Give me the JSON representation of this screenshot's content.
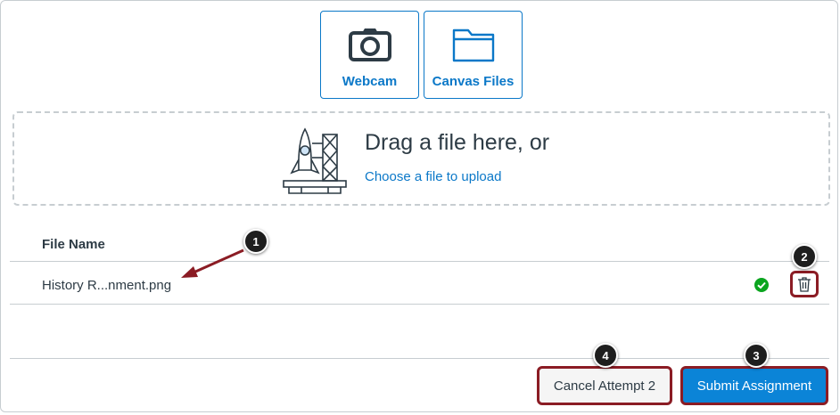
{
  "sources": {
    "webcam_label": "Webcam",
    "canvas_files_label": "Canvas Files"
  },
  "dropzone": {
    "title": "Drag a file here, or",
    "link": "Choose a file to upload"
  },
  "file_table": {
    "header": "File Name",
    "rows": [
      {
        "name": "History R...nment.png",
        "status": "uploaded"
      }
    ]
  },
  "actions": {
    "cancel_label": "Cancel Attempt 2",
    "submit_label": "Submit Assignment"
  },
  "callouts": [
    "1",
    "2",
    "3",
    "4"
  ],
  "colors": {
    "link": "#0b78c8",
    "submit_bg": "#0b84d7",
    "highlight": "#8b1c24",
    "success": "#0ba51f"
  },
  "icons": [
    "camera-icon",
    "folder-icon",
    "rocket-icon",
    "checkmark-icon",
    "trash-icon"
  ]
}
